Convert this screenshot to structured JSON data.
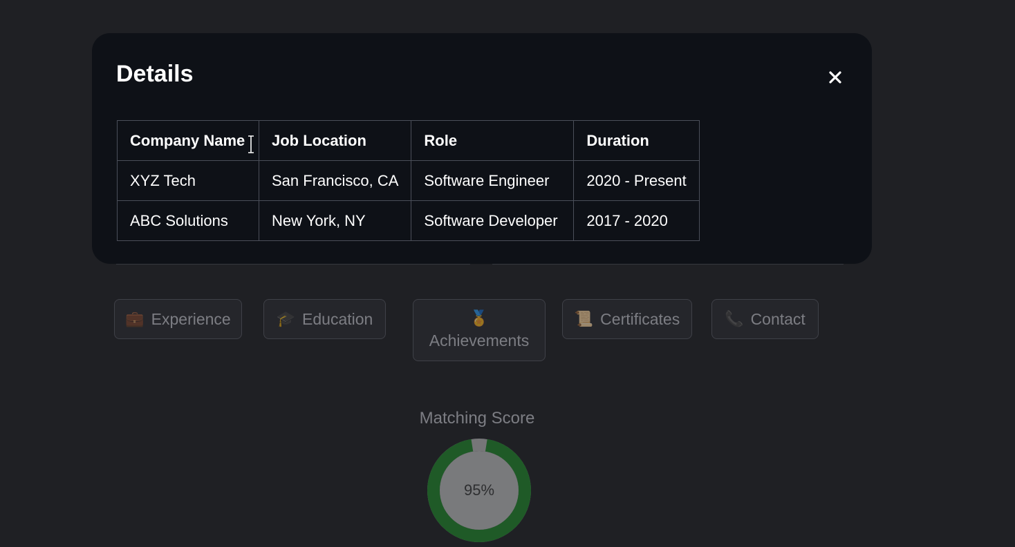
{
  "modal": {
    "title": "Details",
    "close_icon": "close-icon",
    "table": {
      "headers": [
        "Company Name",
        "Job Location",
        "Role",
        "Duration"
      ],
      "rows": [
        [
          "XYZ Tech",
          "San Francisco, CA",
          "Software Engineer",
          "2020 - Present"
        ],
        [
          "ABC Solutions",
          "New York, NY",
          "Software Developer",
          "2017 - 2020"
        ]
      ]
    }
  },
  "nav": {
    "buttons": [
      {
        "label": "Experience",
        "icon": "briefcase-icon",
        "glyph": "💼"
      },
      {
        "label": "Education",
        "icon": "graduation-cap-icon",
        "glyph": "🎓"
      },
      {
        "label": "Achievements",
        "icon": "medal-icon",
        "glyph": "🏅"
      },
      {
        "label": "Certificates",
        "icon": "scroll-icon",
        "glyph": "📜"
      },
      {
        "label": "Contact",
        "icon": "phone-icon",
        "glyph": "📞"
      }
    ]
  },
  "score": {
    "title": "Matching Score",
    "value": 95,
    "label": "95%",
    "colors": {
      "fill": "#1f8a2b",
      "track": "#bdbdbd",
      "center": "#c4c4c4"
    }
  },
  "colors": {
    "page_bg": "#1f2024",
    "modal_bg": "#0e1117",
    "table_border": "#4b4f5a"
  }
}
